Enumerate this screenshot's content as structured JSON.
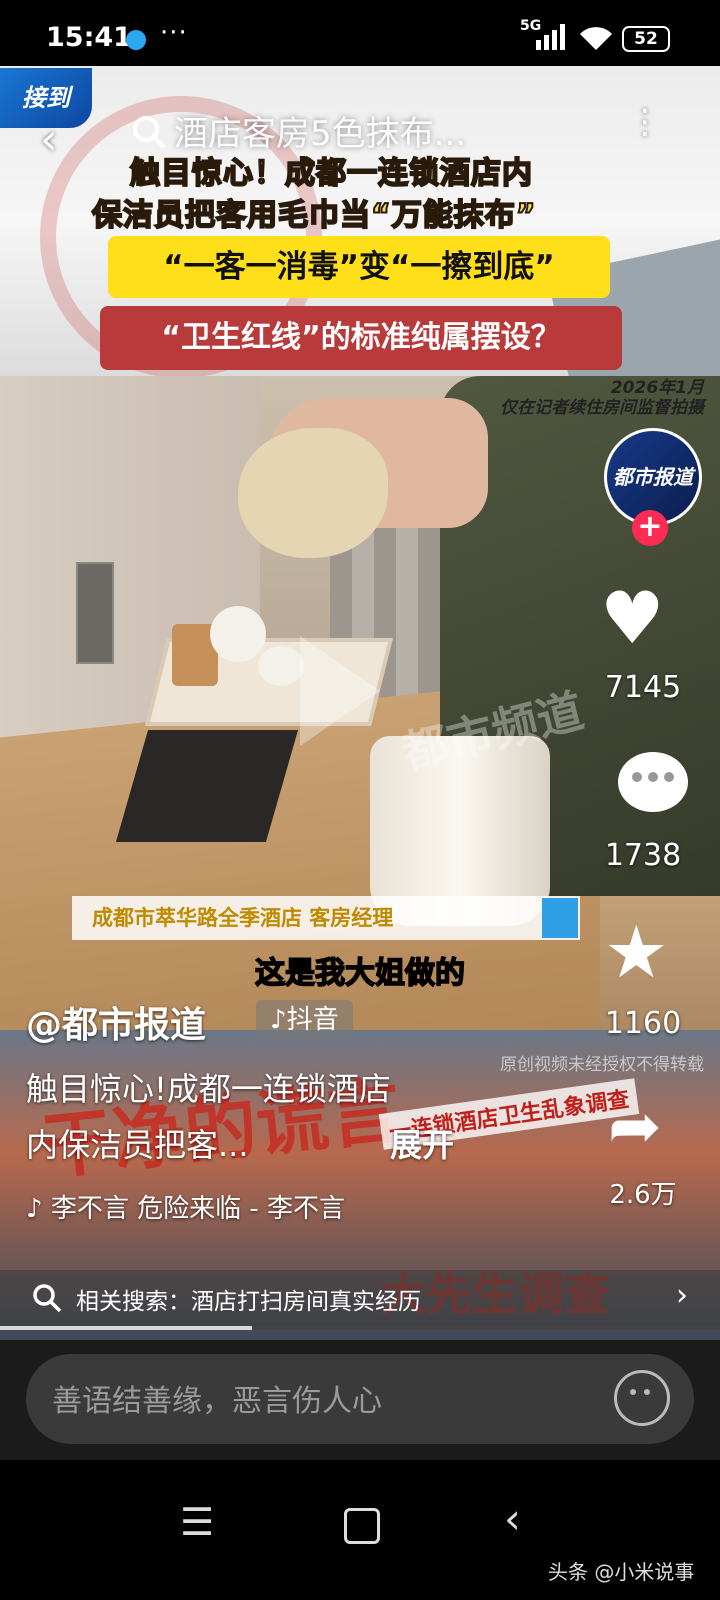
{
  "status_bar": {
    "time": "15:41",
    "more": "···",
    "signal": "5G",
    "battery": "52"
  },
  "header": {
    "search_text": "酒店客房5色抹布...",
    "headline_1": "触目惊心！成都一连锁酒店内",
    "headline_2": "保洁员把客用毛巾当“万能抹布”",
    "yellow_banner": "“一客一消毒”变“一擦到底”",
    "red_banner": "“卫生红线”的标准纯属摆设？",
    "logo_text": "接到"
  },
  "video": {
    "date_overlay_1": "2026年1月",
    "date_overlay_2": "仅在记者续住房间监督拍摄",
    "watermark": "都市频道",
    "caption_bar": "成都市萃华路全季酒店  客房经理",
    "subtitle": "这是我大姐做的",
    "lower_big_text": "干净的谎言",
    "lower_band_text": "一连锁酒店卫生乱象调查",
    "lower_bottom_text": "大先生调查",
    "lower_warning": "原创视频未经授权不得转载"
  },
  "author": {
    "name": "@都市报道",
    "platform_badge": "♪抖音",
    "avatar_text": "都市报道"
  },
  "description": {
    "line_1": "触目惊心!成都一连锁酒店",
    "line_2": "内保洁员把客...",
    "expand": "展开"
  },
  "music": "♪ 李不言    危险来临 - 李不言",
  "related_search": {
    "label": "相关搜索：酒店打扫房间真实经历",
    "chevron": "›"
  },
  "progress": 0.35,
  "rail": {
    "like_count": "7145",
    "comment_count": "1738",
    "favorite_count": "1160",
    "share_count": "2.6万",
    "follow_plus": "+"
  },
  "comment_bar": {
    "placeholder": "善语结善缘，恶言伤人心"
  },
  "nav": {
    "menu_glyph": "☰",
    "back_glyph": "‹",
    "watermark": "头条 @小米说事"
  },
  "colors": {
    "accent_red": "#fe2c55",
    "banner_yellow": "#ffde1a",
    "banner_red": "#b83a3a"
  }
}
